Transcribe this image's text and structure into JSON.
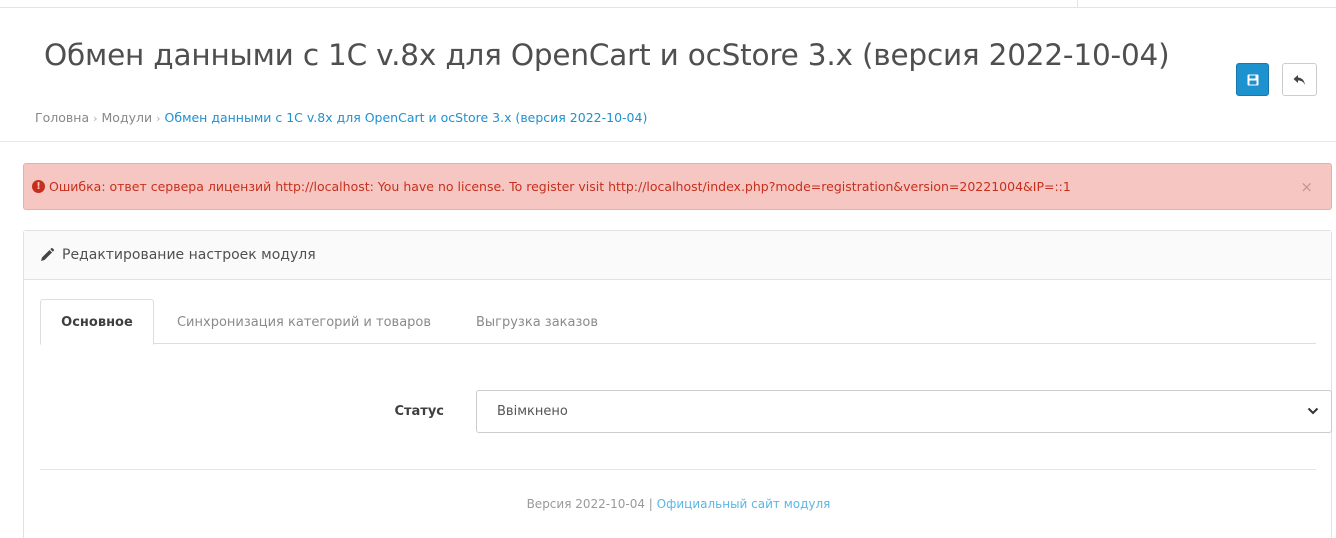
{
  "header": {
    "title": "Обмен данными с 1С v.8x для OpenCart и ocStore 3.x (версия 2022-10-04)",
    "save_icon": "floppy-disk-icon",
    "back_icon": "reply-arrow-icon",
    "accent_color": "#1e91cf"
  },
  "breadcrumb": [
    {
      "label": "Головна"
    },
    {
      "label": "Модули"
    },
    {
      "label": "Обмен данными с 1С v.8x для OpenCart и ocStore 3.x (версия 2022-10-04)"
    }
  ],
  "alert": {
    "icon": "exclamation-circle-icon",
    "message": "Ошибка: ответ сервера лицензий http://localhost: You have no license. To register visit http://localhost/index.php?mode=registration&version=20221004&IP=::1",
    "close": "×",
    "color": "#c72f1d",
    "background": "#f6c7c2"
  },
  "panel": {
    "icon": "pencil-icon",
    "heading": "Редактирование настроек модуля",
    "tabs": [
      {
        "label": "Основное",
        "active": true
      },
      {
        "label": "Синхронизация категорий и товаров",
        "active": false
      },
      {
        "label": "Выгрузка заказов",
        "active": false
      }
    ],
    "status": {
      "label": "Статус",
      "value": "Ввімкнено"
    },
    "footer": {
      "version_text": "Версия 2022-10-04",
      "separator": " | ",
      "link": "Официальный сайт модуля"
    }
  }
}
